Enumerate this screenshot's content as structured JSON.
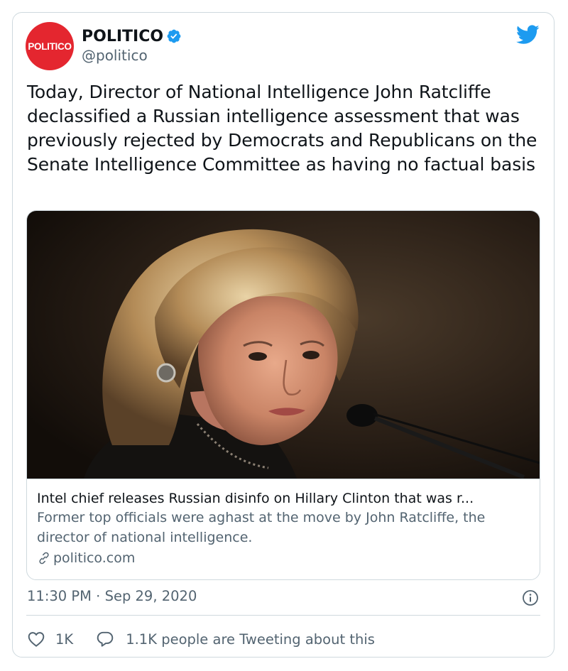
{
  "author": {
    "avatar_text": "POLITICO",
    "display_name": "POLITICO",
    "handle": "@politico",
    "verified": true
  },
  "icons": {
    "brand": "twitter-bird-icon",
    "verified": "verified-badge-icon",
    "link": "link-icon",
    "info": "info-icon",
    "like": "heart-icon",
    "reply": "speech-bubble-icon"
  },
  "colors": {
    "brand_red": "#e4262f",
    "twitter_blue": "#1d9bf0",
    "text_primary": "#0f1419",
    "text_secondary": "#536471",
    "border": "#cfd9de"
  },
  "tweet": {
    "text": "Today, Director of National Intelligence John Ratcliffe declassified a Russian intelligence assessment that was previously rejected by Democrats and Republicans on the Senate Intelligence Committee as having no factual basis",
    "timestamp": "11:30 PM · Sep 29, 2020"
  },
  "link_card": {
    "title": "Intel chief releases Russian disinfo on Hillary Clinton that was r...",
    "description": "Former top officials were aghast at the move by John Ratcliffe, the director of national intelligence.",
    "domain": "politico.com"
  },
  "engagement": {
    "likes": "1K",
    "conversation": "1.1K people are Tweeting about this"
  }
}
